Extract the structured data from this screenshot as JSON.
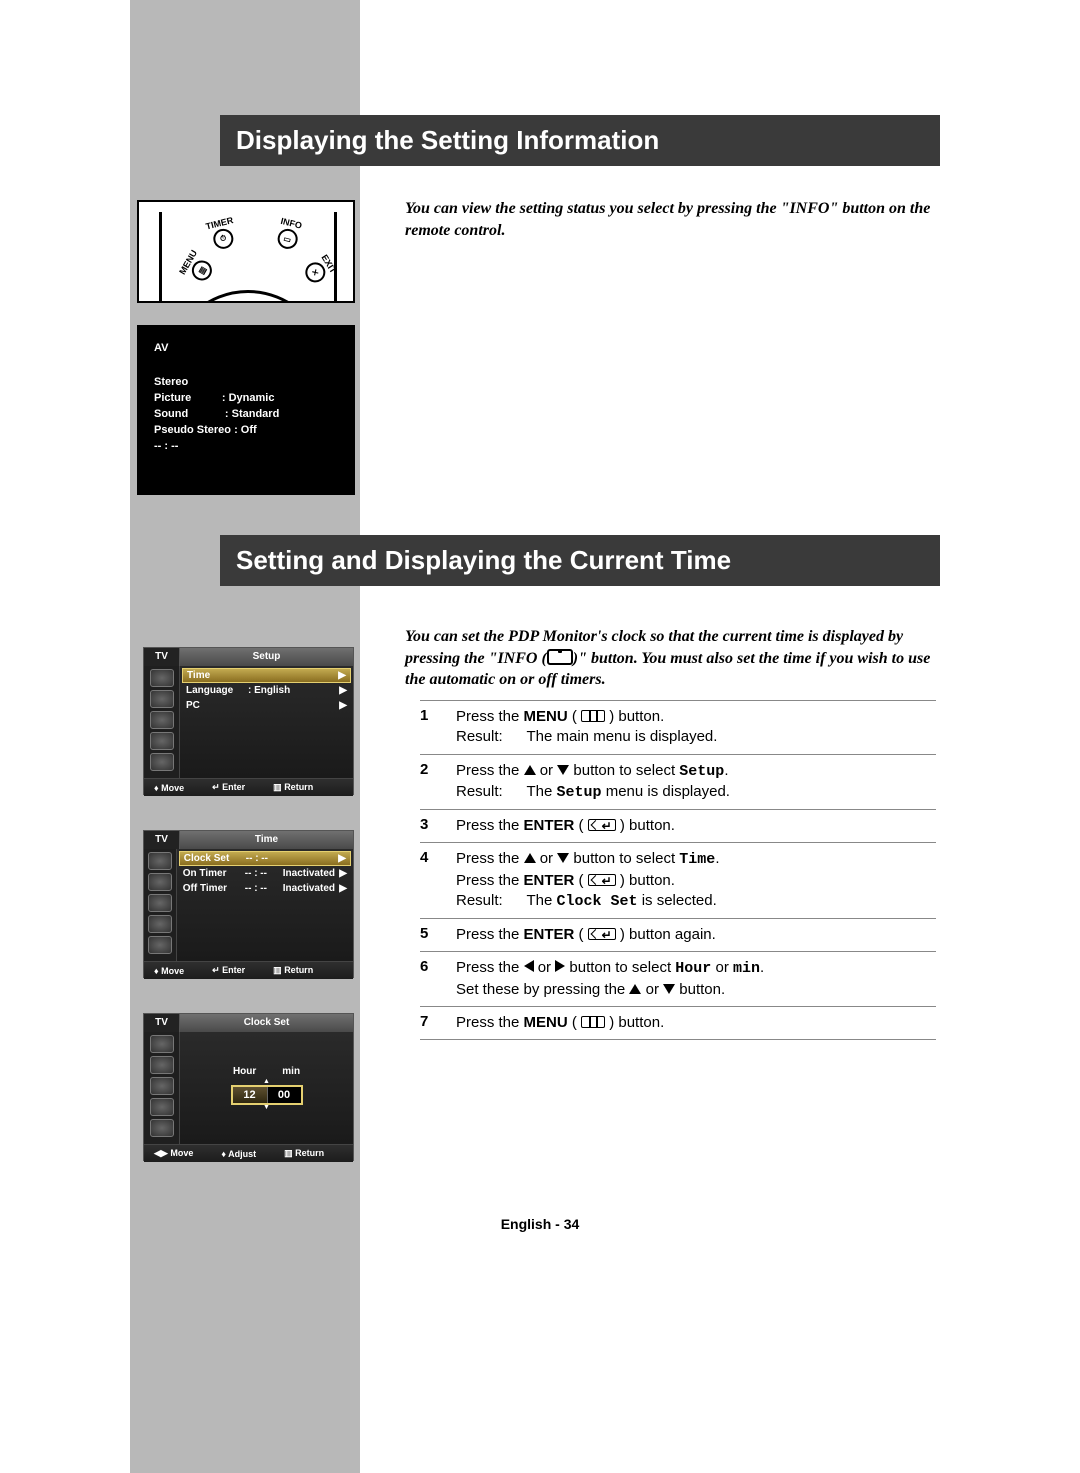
{
  "headings": {
    "h1": "Displaying the Setting Information",
    "h2": "Setting and Displaying the Current Time"
  },
  "intros": {
    "i1": "You can view the setting status you select by pressing the \"INFO\" button on the remote control.",
    "i2_a": "You can set the PDP Monitor's clock so that the current time is displayed by pressing the \"INFO (",
    "i2_b": ")\" button. You must also set the time if you wish to use the automatic on or off timers."
  },
  "remote": {
    "timer": "TIMER",
    "info": "INFO",
    "menu": "MENU",
    "exit": "EXIT"
  },
  "info_osd": {
    "source": "AV",
    "audio": "Stereo",
    "picture_lbl": "Picture",
    "picture_val": ": Dynamic",
    "sound_lbl": "Sound",
    "sound_val": ": Standard",
    "pseudo": "Pseudo Stereo : Off",
    "time": "-- : --"
  },
  "osd_common": {
    "tv": "TV",
    "move": "Move",
    "enter": "Enter",
    "return": "Return",
    "adjust": "Adjust"
  },
  "osd_setup": {
    "title": "Setup",
    "rows": [
      {
        "label": "Time",
        "val": "",
        "sel": true
      },
      {
        "label": "Language",
        "val": ": English",
        "sel": false
      },
      {
        "label": "PC",
        "val": "",
        "sel": false
      }
    ]
  },
  "osd_time": {
    "title": "Time",
    "rows": [
      {
        "label": "Clock Set",
        "val": "-- : --",
        "status": "",
        "sel": true
      },
      {
        "label": "On Timer",
        "val": "-- : --",
        "status": "Inactivated",
        "sel": false
      },
      {
        "label": "Off Timer",
        "val": "-- : --",
        "status": "Inactivated",
        "sel": false
      }
    ]
  },
  "osd_clock": {
    "title": "Clock Set",
    "hour_lbl": "Hour",
    "min_lbl": "min",
    "hour_val": "12",
    "min_val": "00"
  },
  "steps": [
    {
      "n": "1",
      "lines": [
        {
          "t": "Press the ",
          "b": "MENU",
          "icon": "menu",
          "after": " button."
        },
        {
          "result": "The main menu is displayed."
        }
      ]
    },
    {
      "n": "2",
      "lines": [
        {
          "t": "Press the ",
          "tri": "ud",
          "after_plain": " button to select ",
          "mono": "Setup",
          "end": "."
        },
        {
          "result_mono_pre": "The ",
          "mono": "Setup",
          "result_mono_post": " menu is displayed."
        }
      ]
    },
    {
      "n": "3",
      "lines": [
        {
          "t": "Press the ",
          "b": "ENTER",
          "icon": "enter",
          "after": " button."
        }
      ]
    },
    {
      "n": "4",
      "lines": [
        {
          "t": "Press the ",
          "tri": "ud",
          "after_plain": " button to select ",
          "mono": "Time",
          "end": "."
        },
        {
          "t": "Press the ",
          "b": "ENTER",
          "icon": "enter",
          "after": " button."
        },
        {
          "result_mono_pre": "The ",
          "mono": "Clock Set",
          "result_mono_post": " is selected."
        }
      ]
    },
    {
      "n": "5",
      "lines": [
        {
          "t": "Press the ",
          "b": "ENTER",
          "icon": "enter",
          "after": " button again."
        }
      ]
    },
    {
      "n": "6",
      "lines": [
        {
          "t": "Press the ",
          "tri": "lr",
          "after_plain": " button to select ",
          "mono": "Hour",
          "mid": " or ",
          "mono2": "min",
          "end": "."
        },
        {
          "plain": "Set these by pressing the ",
          "tri": "ud",
          "after_plain2": " button."
        }
      ]
    },
    {
      "n": "7",
      "lines": [
        {
          "t": "Press the ",
          "b": "MENU",
          "icon": "menu",
          "after": " button."
        }
      ]
    }
  ],
  "footer": "English - 34",
  "result_label": "Result:"
}
